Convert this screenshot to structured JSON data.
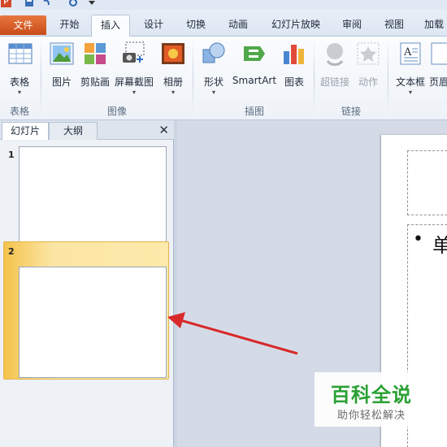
{
  "quick_access": {
    "icons": [
      "powerpoint-logo",
      "save-icon",
      "undo-icon",
      "redo-icon",
      "customize-icon"
    ]
  },
  "tabs": {
    "file": "文件",
    "home": "开始",
    "insert": "插入",
    "design": "设计",
    "transitions": "切换",
    "animations": "动画",
    "slideshow": "幻灯片放映",
    "review": "审阅",
    "view": "视图",
    "addins": "加载"
  },
  "ribbon": {
    "table": "表格",
    "picture": "图片",
    "clipart": "剪贴画",
    "screenshot": "屏幕截图",
    "album": "相册",
    "shapes": "形状",
    "smartart": "SmartArt",
    "chart": "图表",
    "hyperlink": "超链接",
    "action": "动作",
    "textbox": "文本框",
    "header": "页眉",
    "groups": {
      "tables": "表格",
      "images": "图像",
      "illustrations": "插图",
      "links": "链接"
    },
    "colors": {
      "file_tab": "#d24726",
      "accent": "#2a6ebb"
    }
  },
  "panel": {
    "tab_slides": "幻灯片",
    "tab_outline": "大纲",
    "close": "✕",
    "slides": [
      {
        "number": "1"
      },
      {
        "number": "2"
      }
    ]
  },
  "slide": {
    "bullet": "•",
    "body_text": "单"
  },
  "watermark": {
    "title": "百科全说",
    "subtitle": "助你轻松解决"
  }
}
